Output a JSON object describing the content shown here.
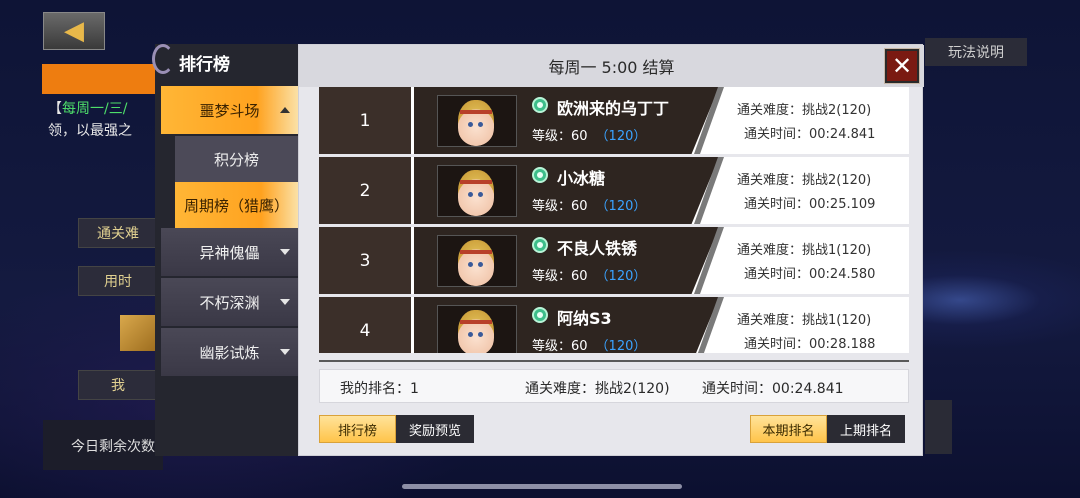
{
  "background": {
    "back_arrow": "◀",
    "rules_label": "玩法说明",
    "bg_text_1a": "【",
    "bg_text_1b": "每周一/三/",
    "bg_text_2": "领，以最强之",
    "bg_box_1": "通关难",
    "bg_box_2": "用时",
    "bg_box_3": "我",
    "bg_bottom": "今日剩余次数"
  },
  "sidebar": {
    "title": "排行榜",
    "items": [
      {
        "label": "噩梦斗场",
        "active": true,
        "expanded": true
      },
      {
        "label": "积分榜",
        "sub": true,
        "active": false
      },
      {
        "label": "周期榜（猎鹰）",
        "sub": true,
        "active": true
      },
      {
        "label": "异神傀儡",
        "active": false
      },
      {
        "label": "不朽深渊",
        "active": false
      },
      {
        "label": "幽影试炼",
        "active": false
      }
    ]
  },
  "header": {
    "title": "每周一 5:00 结算",
    "close": "✕"
  },
  "rows": [
    {
      "rank": "1",
      "name": "欧洲来的乌丁丁",
      "level_label": "等级：60",
      "level_extra": "（120）",
      "difficulty": "通关难度：挑战2(120)",
      "time": "通关时间：00:24.841"
    },
    {
      "rank": "2",
      "name": "小冰糖",
      "level_label": "等级：60",
      "level_extra": "（120）",
      "difficulty": "通关难度：挑战2(120)",
      "time": "通关时间：00:25.109"
    },
    {
      "rank": "3",
      "name": "不良人铁锈",
      "level_label": "等级：60",
      "level_extra": "（120）",
      "difficulty": "通关难度：挑战1(120)",
      "time": "通关时间：00:24.580"
    },
    {
      "rank": "4",
      "name": "阿纳S3",
      "level_label": "等级：60",
      "level_extra": "（120）",
      "difficulty": "通关难度：挑战1(120)",
      "time": "通关时间：00:28.188"
    }
  ],
  "my_rank": {
    "rank": "我的排名：1",
    "difficulty": "通关难度：挑战2(120)",
    "time": "通关时间：00:24.841"
  },
  "bottom_tabs": {
    "leaderboard": "排行榜",
    "reward_preview": "奖励预览",
    "this_period": "本期排名",
    "last_period": "上期排名"
  },
  "colors": {
    "accent_orange": "#ffa21f",
    "rank_bg": "#3b2f29",
    "level_blue": "#3aa3ff",
    "close_red": "#7a1a12"
  }
}
